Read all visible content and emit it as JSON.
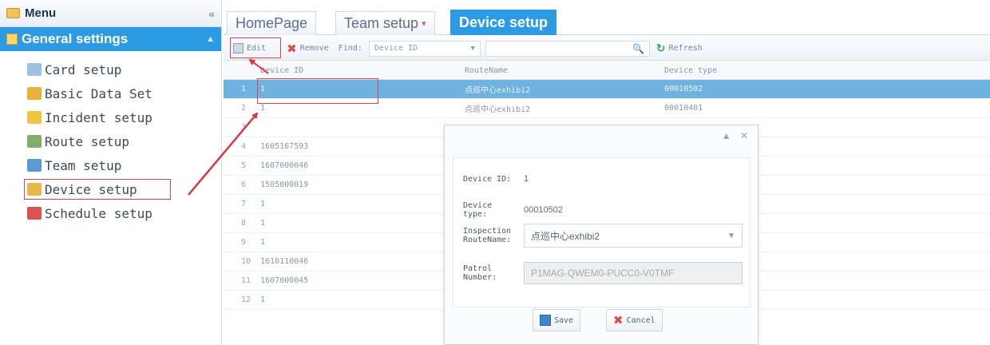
{
  "menu": {
    "title": "Menu",
    "collapse_glyph": "«",
    "group_label": "General settings",
    "group_toggle_glyph": "▲",
    "items": [
      {
        "label": "Card setup",
        "icon": "card-icon",
        "color": "#9cc3de"
      },
      {
        "label": "Basic Data Set",
        "icon": "data-icon",
        "color": "#e8b23a"
      },
      {
        "label": "Incident setup",
        "icon": "incident-icon",
        "color": "#f0c640"
      },
      {
        "label": "Route setup",
        "icon": "route-icon",
        "color": "#7fae6a"
      },
      {
        "label": "Team setup",
        "icon": "team-icon",
        "color": "#5b9bd5"
      },
      {
        "label": "Device setup",
        "icon": "device-icon",
        "color": "#e9b84a"
      },
      {
        "label": "Schedule setup",
        "icon": "schedule-icon",
        "color": "#d9534f"
      }
    ]
  },
  "tabs": [
    {
      "label": "HomePage"
    },
    {
      "label": "Team setup",
      "caret": "▾"
    },
    {
      "label": "Device setup"
    }
  ],
  "toolbar": {
    "edit_label": "Edit",
    "remove_label": "Remove",
    "find_label": "Find:",
    "find_field": "Device ID",
    "search_glyph": "🔍",
    "refresh_label": "Refresh"
  },
  "grid": {
    "columns": [
      "Device ID",
      "RouteName",
      "Device type"
    ],
    "rows": [
      {
        "n": "1",
        "id": "1",
        "route": "点巡中心exhibi2",
        "type": "00010502"
      },
      {
        "n": "2",
        "id": "1",
        "route": "点巡中心exhibi2",
        "type": "00010401"
      },
      {
        "n": "3",
        "id": "",
        "route": "",
        "type": ""
      },
      {
        "n": "4",
        "id": "1605167593",
        "route": "",
        "type": ""
      },
      {
        "n": "5",
        "id": "1607000046",
        "route": "",
        "type": ""
      },
      {
        "n": "6",
        "id": "1505000019",
        "route": "",
        "type": ""
      },
      {
        "n": "7",
        "id": "1",
        "route": "",
        "type": ""
      },
      {
        "n": "8",
        "id": "1",
        "route": "",
        "type": ""
      },
      {
        "n": "9",
        "id": "1",
        "route": "",
        "type": ""
      },
      {
        "n": "10",
        "id": "1610110046",
        "route": "",
        "type": ""
      },
      {
        "n": "11",
        "id": "1607000045",
        "route": "",
        "type": ""
      },
      {
        "n": "12",
        "id": "1",
        "route": "",
        "type": ""
      }
    ]
  },
  "dialog": {
    "tools_glyphs": "▲ ✕",
    "device_id_label": "Device ID:",
    "device_id_value": "1",
    "device_type_label": "Device type:",
    "device_type_value": "00010502",
    "route_label_1": "Inspection",
    "route_label_2": "RouteName:",
    "route_value": "点巡中心exhibi2",
    "patrol_label_1": "Patrol",
    "patrol_label_2": "Number:",
    "patrol_value": "P1MAG-QWEM0-PUCC0-V0TMF",
    "save_label": "Save",
    "cancel_label": "Cancel"
  },
  "colors": {
    "accent": "#2c9be3",
    "highlight": "#e0434a",
    "row_selected": "#6fb1df"
  }
}
